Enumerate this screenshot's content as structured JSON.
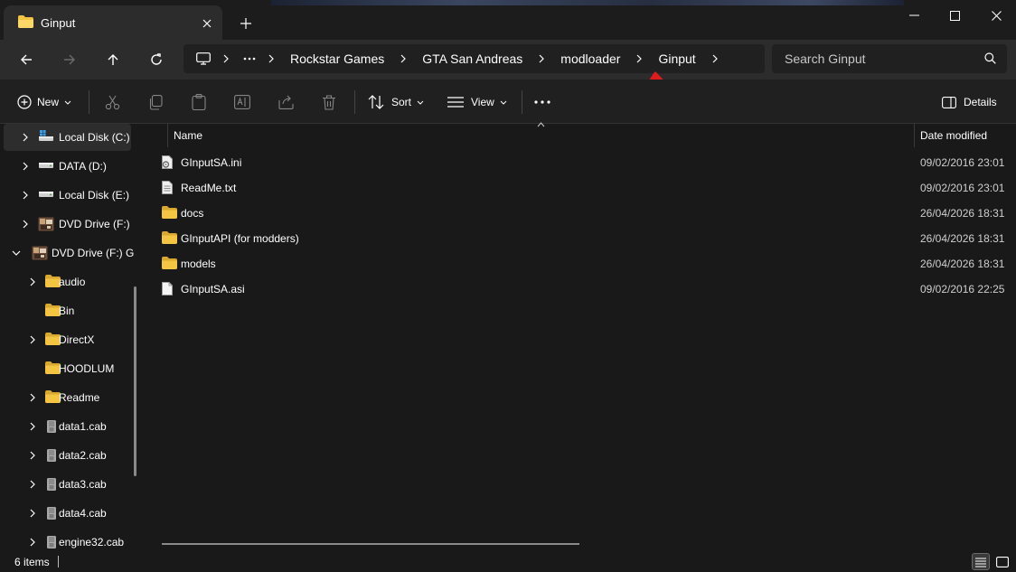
{
  "window": {
    "tab_title": "Ginput"
  },
  "navigation": {
    "breadcrumbs": [
      "Rockstar Games",
      "GTA San Andreas",
      "modloader",
      "Ginput"
    ],
    "search_placeholder": "Search Ginput"
  },
  "commands": {
    "new_label": "New",
    "sort_label": "Sort",
    "view_label": "View",
    "details_label": "Details"
  },
  "sidebar": {
    "items": [
      {
        "label": "Local Disk (C:)",
        "icon": "windows-drive-icon",
        "selected": true
      },
      {
        "label": "DATA (D:)",
        "icon": "drive-icon"
      },
      {
        "label": "Local Disk (E:)",
        "icon": "drive-icon"
      },
      {
        "label": "DVD Drive (F:)",
        "icon": "dvd-game-icon"
      },
      {
        "label": "DVD Drive (F:) G",
        "icon": "dvd-game-icon",
        "expanded": true
      },
      {
        "label": "audio",
        "icon": "folder-icon"
      },
      {
        "label": "Bin",
        "icon": "folder-icon"
      },
      {
        "label": "DirectX",
        "icon": "folder-icon"
      },
      {
        "label": "HOODLUM",
        "icon": "folder-icon"
      },
      {
        "label": "Readme",
        "icon": "folder-icon"
      },
      {
        "label": "data1.cab",
        "icon": "cab-file-icon"
      },
      {
        "label": "data2.cab",
        "icon": "cab-file-icon"
      },
      {
        "label": "data3.cab",
        "icon": "cab-file-icon"
      },
      {
        "label": "data4.cab",
        "icon": "cab-file-icon"
      },
      {
        "label": "engine32.cab",
        "icon": "cab-file-icon"
      }
    ]
  },
  "files": {
    "columns": {
      "name": "Name",
      "date": "Date modified"
    },
    "rows": [
      {
        "name": "GInputSA.ini",
        "date": "09/02/2016 23:01",
        "icon": "settings-file-icon"
      },
      {
        "name": "ReadMe.txt",
        "date": "09/02/2016 23:01",
        "icon": "text-file-icon"
      },
      {
        "name": "docs",
        "date": "26/04/2026 18:31",
        "icon": "folder-icon"
      },
      {
        "name": "GInputAPI (for modders)",
        "date": "26/04/2026 18:31",
        "icon": "folder-icon"
      },
      {
        "name": "models",
        "date": "26/04/2026 18:31",
        "icon": "folder-icon"
      },
      {
        "name": "GInputSA.asi",
        "date": "09/02/2016 22:25",
        "icon": "file-icon"
      }
    ]
  },
  "status": {
    "item_count": "6 items"
  },
  "colors": {
    "folder": "#f4c542",
    "annotation_arrow": "#e01b1b",
    "background": "#191919"
  }
}
